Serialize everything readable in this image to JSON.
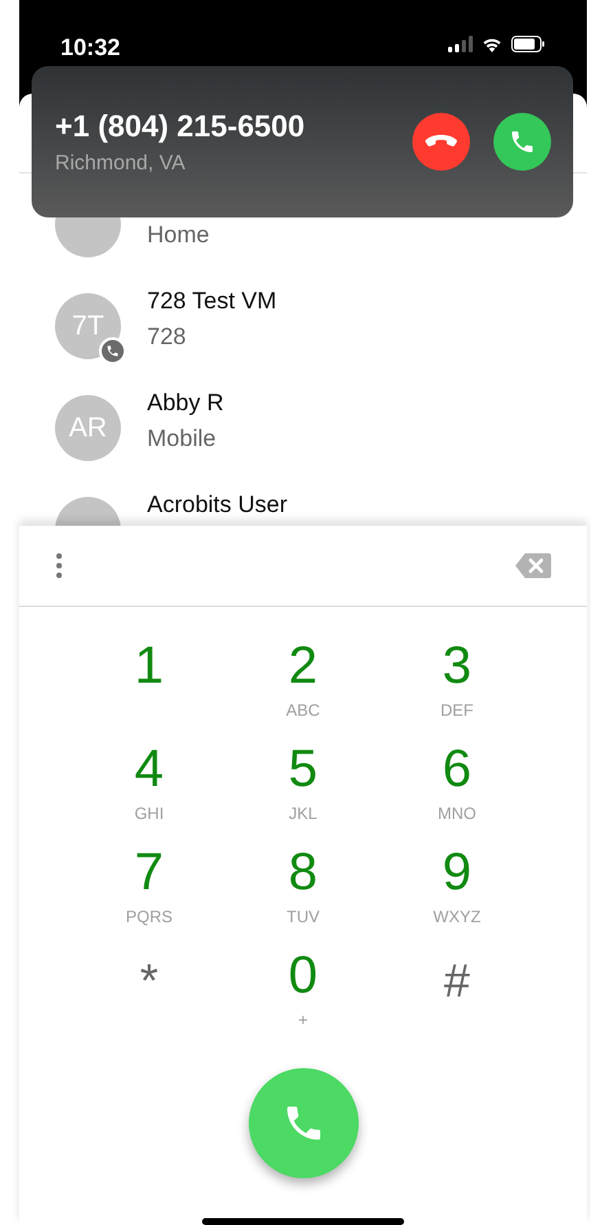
{
  "status_bar": {
    "time": "10:32"
  },
  "incoming_call": {
    "number": "+1 (804) 215-6500",
    "location": "Richmond, VA"
  },
  "contacts": [
    {
      "subtitle": "Home",
      "phone_badge": false
    },
    {
      "initials": "7T",
      "name": "728 Test VM",
      "subtitle": "728",
      "phone_badge": true
    },
    {
      "initials": "AR",
      "name": "Abby R",
      "subtitle": "Mobile",
      "phone_badge": false
    },
    {
      "name": "Acrobits User",
      "phone_badge": false
    }
  ],
  "keypad": [
    {
      "kind": "digit",
      "label": "1"
    },
    {
      "kind": "digit",
      "label": "2",
      "letters": "ABC"
    },
    {
      "kind": "digit",
      "label": "3",
      "letters": "DEF"
    },
    {
      "kind": "digit",
      "label": "4",
      "letters": "GHI"
    },
    {
      "kind": "digit",
      "label": "5",
      "letters": "JKL"
    },
    {
      "kind": "digit",
      "label": "6",
      "letters": "MNO"
    },
    {
      "kind": "digit",
      "label": "7",
      "letters": "PQRS"
    },
    {
      "kind": "digit",
      "label": "8",
      "letters": "TUV"
    },
    {
      "kind": "digit",
      "label": "9",
      "letters": "WXYZ"
    },
    {
      "kind": "symbol",
      "label": "*"
    },
    {
      "kind": "digit",
      "label": "0",
      "letters": "+"
    },
    {
      "kind": "symbol",
      "label": "#"
    }
  ]
}
